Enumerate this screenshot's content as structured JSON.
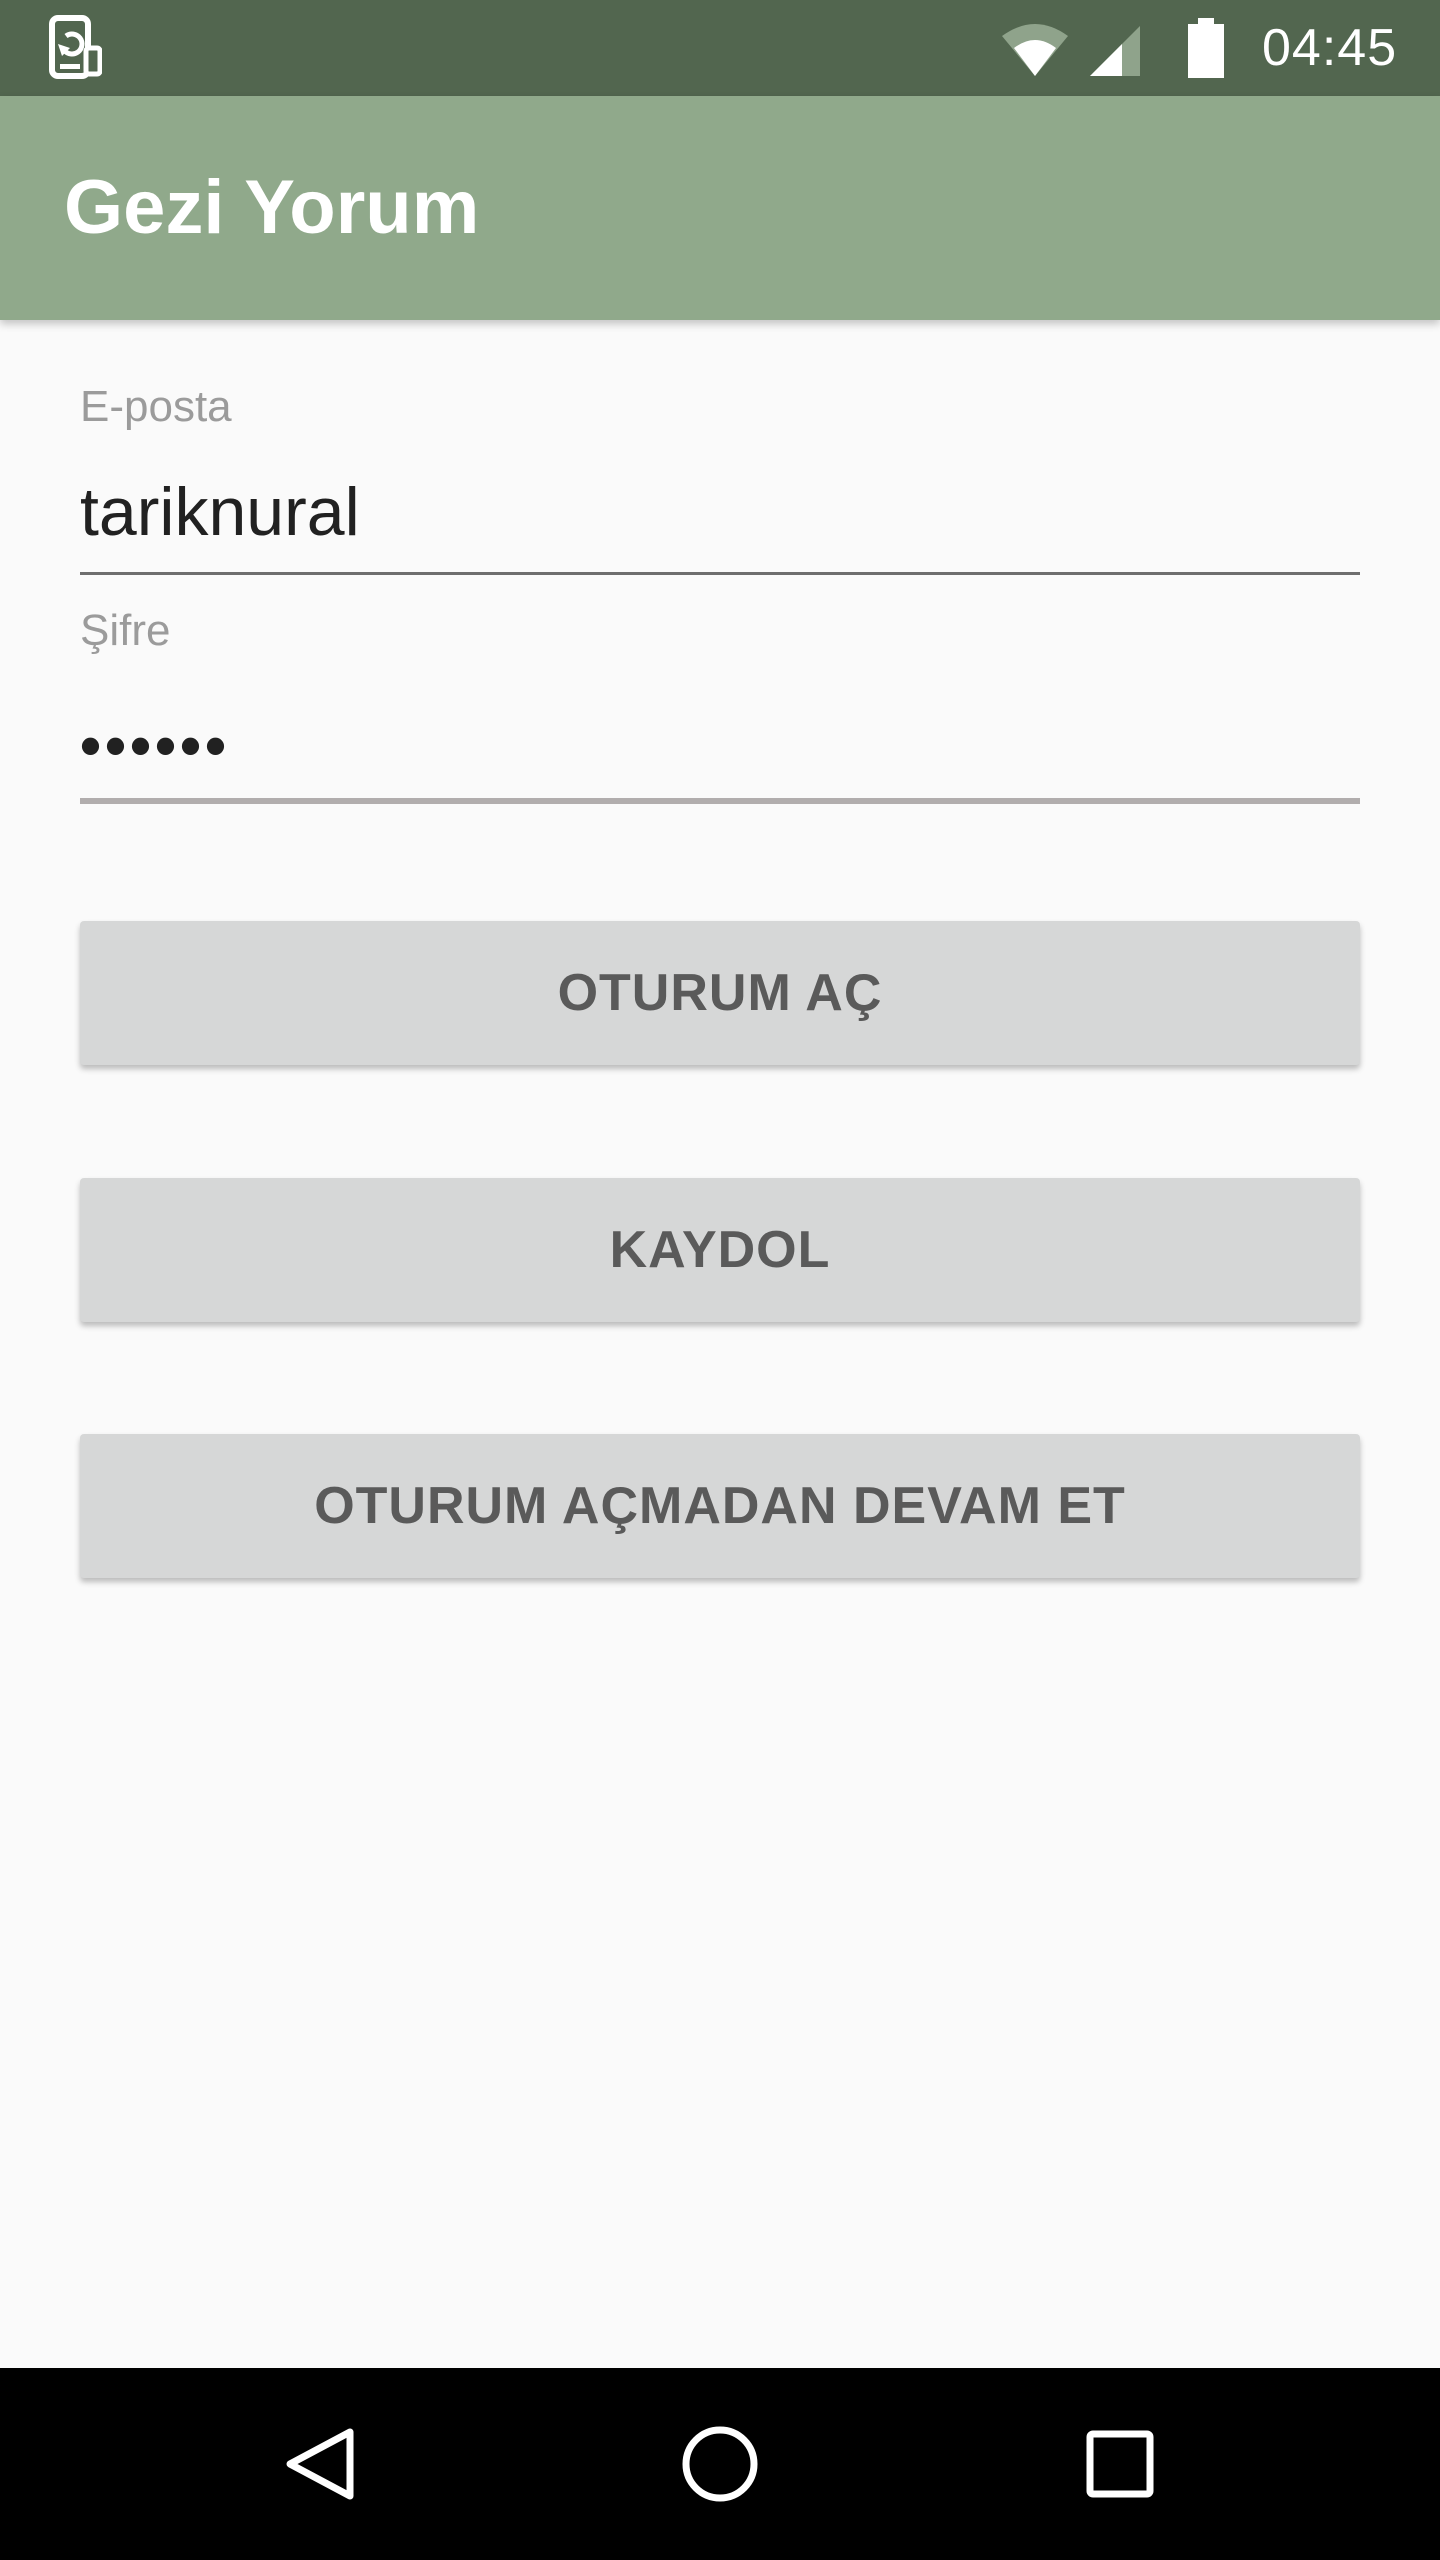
{
  "status_bar": {
    "time": "04:45",
    "icons": [
      "screen-rotation-icon",
      "wifi-icon",
      "cell-signal-icon",
      "battery-icon"
    ],
    "background": "#52664f"
  },
  "app_bar": {
    "title": "Gezi Yorum",
    "background": "#90a98b"
  },
  "form": {
    "email": {
      "label": "E-posta",
      "value": "tariknural"
    },
    "password": {
      "label": "Şifre",
      "value": "••••••"
    }
  },
  "buttons": {
    "login": "OTURUM AÇ",
    "register": "KAYDOL",
    "guest": "OTURUM AÇMADAN DEVAM ET"
  },
  "nav_bar": {
    "icons": [
      "back-icon",
      "home-icon",
      "recents-icon"
    ]
  }
}
